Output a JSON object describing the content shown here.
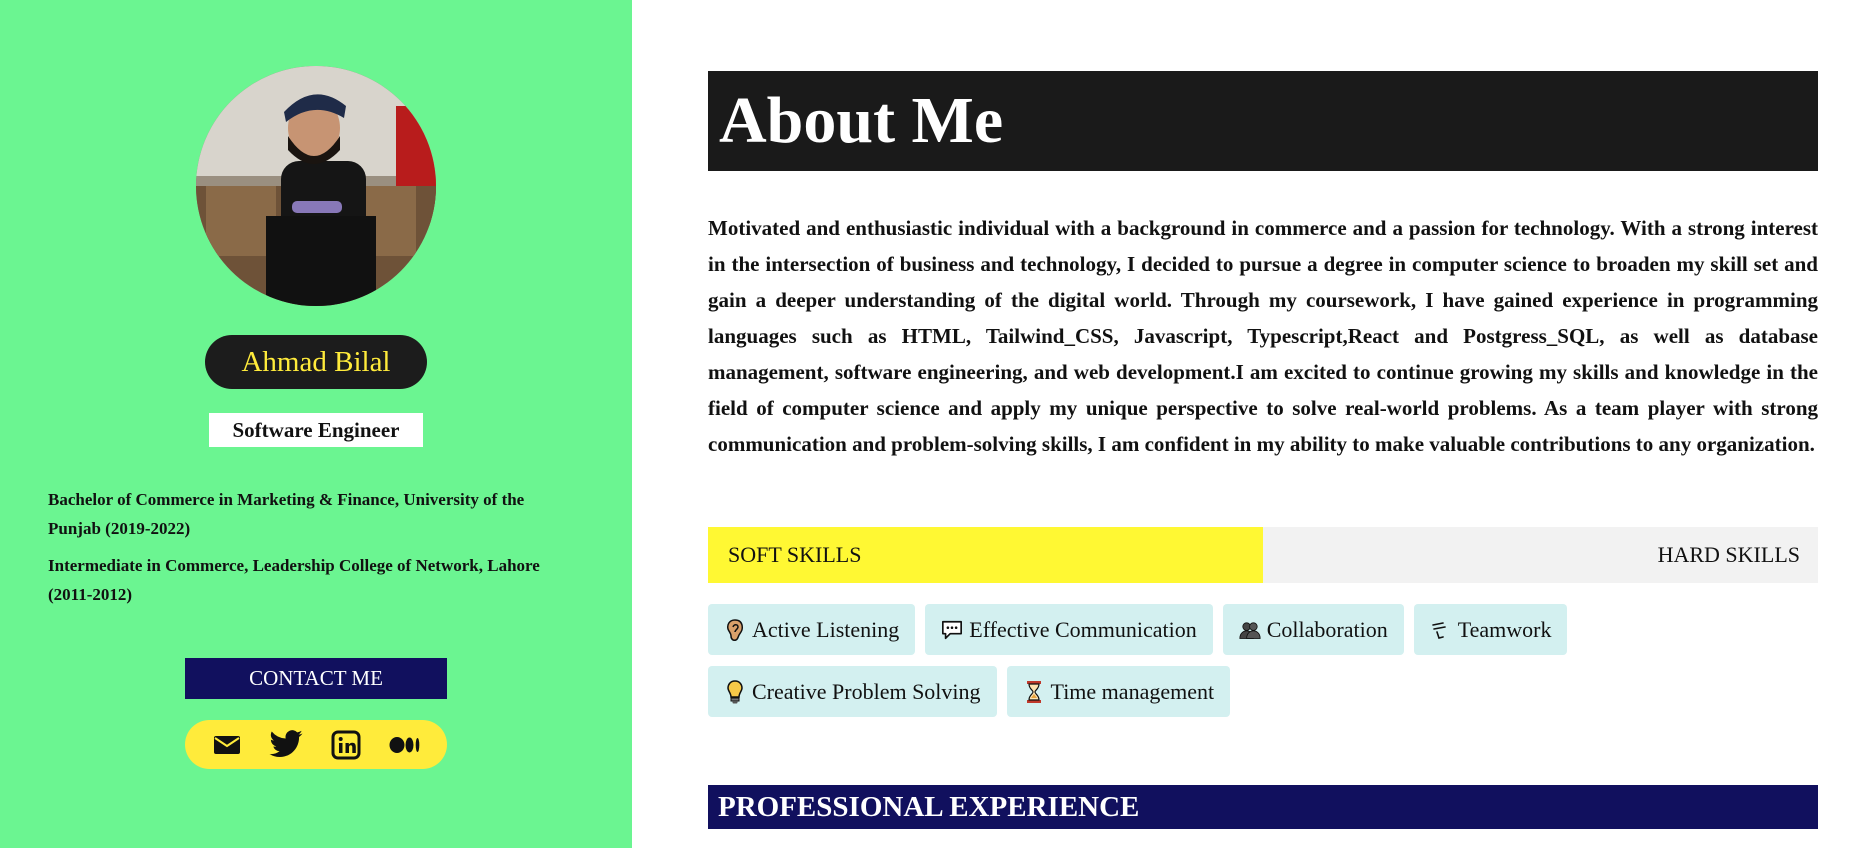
{
  "profile": {
    "name": "Ahmad Bilal",
    "title": "Software Engineer",
    "education": [
      "Bachelor of Commerce in Marketing & Finance, University of the Punjab (2019-2022)",
      "Intermediate in Commerce, Leadership College of Network, Lahore (2011-2012)"
    ],
    "contact_label": "CONTACT ME",
    "social_icons": [
      "mail-icon",
      "twitter-icon",
      "linkedin-icon",
      "medium-icon"
    ]
  },
  "about": {
    "heading": "About Me",
    "text": "Motivated and enthusiastic individual with a background in commerce and a passion for technology. With a strong interest in the intersection of business and technology, I decided to pursue a degree in computer science to broaden my skill set and gain a deeper understanding of the digital world. Through my coursework, I have gained experience in programming languages such as HTML, Tailwind_CSS, Javascript, Typescript,React and Postgress_SQL, as well as database management, software engineering, and web development.I am excited to continue growing my skills and knowledge in the field of computer science and apply my unique perspective to solve real-world problems. As a team player with strong communication and problem-solving skills, I am confident in my ability to make valuable contributions to any organization."
  },
  "skills": {
    "tabs": {
      "soft": "SOFT SKILLS",
      "hard": "HARD SKILLS",
      "active": "soft"
    },
    "soft": [
      {
        "label": "Active Listening",
        "icon": "ear-icon"
      },
      {
        "label": "Effective Communication",
        "icon": "speech-bubble-icon"
      },
      {
        "label": "Collaboration",
        "icon": "people-icon"
      },
      {
        "label": "Teamwork",
        "icon": "teamwork-icon"
      },
      {
        "label": "Creative Problem Solving",
        "icon": "lightbulb-icon"
      },
      {
        "label": "Time management",
        "icon": "hourglass-icon"
      }
    ]
  },
  "experience": {
    "heading": "PROFESSIONAL EXPERIENCE"
  },
  "colors": {
    "sidebar_bg": "#6bf591",
    "accent_yellow": "#ffeb3b",
    "navy": "#11105e",
    "chip_bg": "#d3f0f0",
    "header_dark": "#1a1a1a"
  }
}
